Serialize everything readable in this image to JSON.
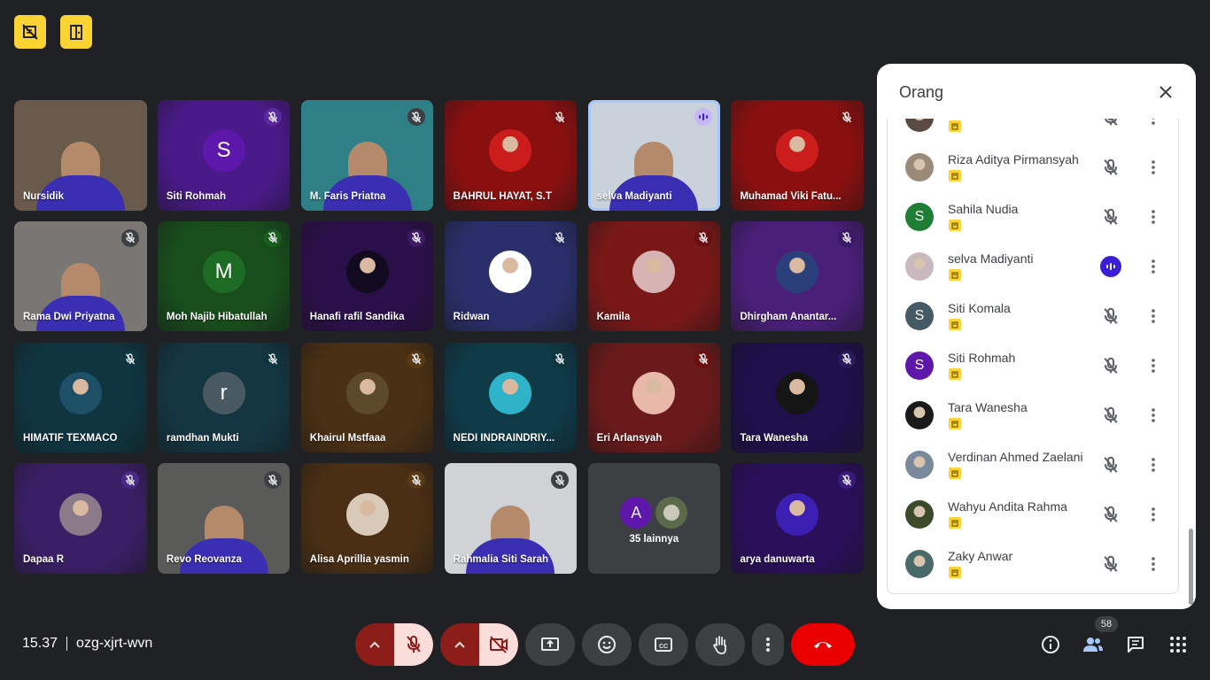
{
  "tiles": [
    {
      "name": "Nursidik",
      "type": "video",
      "bg": "#6a5a4c",
      "mic": "none"
    },
    {
      "name": "Siti Rohmah",
      "type": "avatar",
      "bg": "#4a1a8a",
      "avatar_letter": "S",
      "avatar_color": "#5e17ab",
      "mic": "muted",
      "mic_bg": "#5b2aa0"
    },
    {
      "name": "M. Faris Priatna",
      "type": "video",
      "bg": "#2e7f86",
      "mic": "muted",
      "mic_bg": "#3c4043"
    },
    {
      "name": "BAHRUL HAYAT, S.T",
      "type": "photo",
      "bg": "#8a1010",
      "avatar_color": "#cc1d1d",
      "mic": "muted",
      "mic_bg": "#7a0f0f"
    },
    {
      "name": "selva Madiyanti",
      "type": "video",
      "bg": "#c9d2db",
      "mic": "speaking",
      "mic_bg": "#c7b8f5",
      "active": true
    },
    {
      "name": "Muhamad Viki Fatu...",
      "type": "photo",
      "bg": "#8a1010",
      "avatar_color": "#cc1d1d",
      "mic": "muted",
      "mic_bg": "#7a0f0f"
    },
    {
      "name": "Rama Dwi Priyatna",
      "type": "video",
      "bg": "#7a7674",
      "mic": "muted",
      "mic_bg": "#3c4043"
    },
    {
      "name": "Moh Najib Hibatullah",
      "type": "avatar",
      "bg": "#184d1c",
      "avatar_letter": "M",
      "avatar_color": "#1e6b26",
      "mic": "muted",
      "mic_bg": "#1b5e20"
    },
    {
      "name": "Hanafi rafil Sandika",
      "type": "photo",
      "bg": "#2b0f4a",
      "avatar_color": "#120b1f",
      "mic": "muted",
      "mic_bg": "#3d1a63"
    },
    {
      "name": "Ridwan",
      "type": "photo",
      "bg": "#2a2f6b",
      "avatar_color": "#ffffff",
      "mic": "muted",
      "mic_bg": "#232a5c"
    },
    {
      "name": "Kamila",
      "type": "photo",
      "bg": "#7a1818",
      "avatar_color": "#d8b3b3",
      "mic": "muted",
      "mic_bg": "#6a1010"
    },
    {
      "name": "Dhirgham Anantar...",
      "type": "photo",
      "bg": "#4a1f7a",
      "avatar_color": "#2b3f7a",
      "mic": "muted",
      "mic_bg": "#3a1a66"
    },
    {
      "name": "HIMATIF TEXMACO",
      "type": "photo",
      "bg": "#0f3540",
      "avatar_color": "#1d4f66",
      "mic": "muted",
      "mic_bg": "#0f3540"
    },
    {
      "name": "ramdhan Mukti",
      "type": "avatar",
      "bg": "#143642",
      "avatar_letter": "r",
      "avatar_color": "#4a5a63",
      "mic": "muted",
      "mic_bg": "#0f3540"
    },
    {
      "name": "Khairul Mstfaaa",
      "type": "photo",
      "bg": "#4a3014",
      "avatar_color": "#5c4a2a",
      "mic": "muted",
      "mic_bg": "#5a3a14"
    },
    {
      "name": "NEDI INDRAINDRIY...",
      "type": "photo",
      "bg": "#0f3a47",
      "avatar_color": "#2fb3c9",
      "mic": "muted",
      "mic_bg": "#0f3540"
    },
    {
      "name": "Eri Arlansyah",
      "type": "photo",
      "bg": "#6a1a1a",
      "avatar_color": "#e8b8a8",
      "mic": "muted",
      "mic_bg": "#6a1010"
    },
    {
      "name": "Tara Wanesha",
      "type": "photo",
      "bg": "#1f0f4a",
      "avatar_color": "#151515",
      "mic": "muted",
      "mic_bg": "#2a1a5c"
    },
    {
      "name": "Dapaa R",
      "type": "photo",
      "bg": "#3a1f66",
      "avatar_color": "#8a7a8a",
      "mic": "muted",
      "mic_bg": "#4a2a88"
    },
    {
      "name": "Revo Reovanza",
      "type": "video",
      "bg": "#5a5a58",
      "mic": "muted",
      "mic_bg": "#3c4043"
    },
    {
      "name": "Alisa Aprillia yasmin",
      "type": "photo",
      "bg": "#4a2f14",
      "avatar_color": "#d9c9b9",
      "mic": "muted",
      "mic_bg": "#5a3a14"
    },
    {
      "name": "Rahmalia Siti Sarah",
      "type": "video",
      "bg": "#d0d2d6",
      "mic": "muted",
      "mic_bg": "#3c4043"
    },
    {
      "name": "35 lainnya",
      "type": "more",
      "bg": "#3c4043",
      "more_letter": "A",
      "more_color": "#5e17ab",
      "mic": "none"
    },
    {
      "name": "arya danuwarta",
      "type": "photo",
      "bg": "#2a0f5a",
      "avatar_color": "#3b1fb3",
      "mic": "muted",
      "mic_bg": "#3a1a7a"
    }
  ],
  "panel": {
    "title": "Orang",
    "people": [
      {
        "name": "",
        "avatar": "photo",
        "color": "#5a4a44",
        "mic": "muted"
      },
      {
        "name": "Riza Aditya Pirmansyah",
        "avatar": "photo",
        "color": "#9a8a7a",
        "mic": "muted"
      },
      {
        "name": "Sahila Nudia",
        "avatar": "letter",
        "letter": "S",
        "color": "#1e7e34",
        "mic": "muted"
      },
      {
        "name": "selva Madiyanti",
        "avatar": "photo",
        "color": "#c9b9bf",
        "mic": "speaking"
      },
      {
        "name": "Siti Komala",
        "avatar": "letter",
        "letter": "S",
        "color": "#455a64",
        "mic": "muted"
      },
      {
        "name": "Siti Rohmah",
        "avatar": "letter",
        "letter": "S",
        "color": "#5e17ab",
        "mic": "muted"
      },
      {
        "name": "Tara Wanesha",
        "avatar": "photo",
        "color": "#1a1a1a",
        "mic": "muted"
      },
      {
        "name": "Verdinan Ahmed Zaelani",
        "avatar": "photo",
        "color": "#7a8a9a",
        "mic": "muted"
      },
      {
        "name": "Wahyu Andita Rahma",
        "avatar": "photo",
        "color": "#3a4a2a",
        "mic": "muted"
      },
      {
        "name": "Zaky Anwar",
        "avatar": "photo",
        "color": "#4a6a6a",
        "mic": "muted"
      }
    ]
  },
  "meeting": {
    "time": "15.37",
    "code": "ozg-xjrt-wvn"
  },
  "people_count": "58",
  "colors": {
    "accent_yellow": "#fbd332",
    "end_call": "#ea0000",
    "muted_red": "#8c1d18",
    "speaking": "#3b1fd8"
  }
}
